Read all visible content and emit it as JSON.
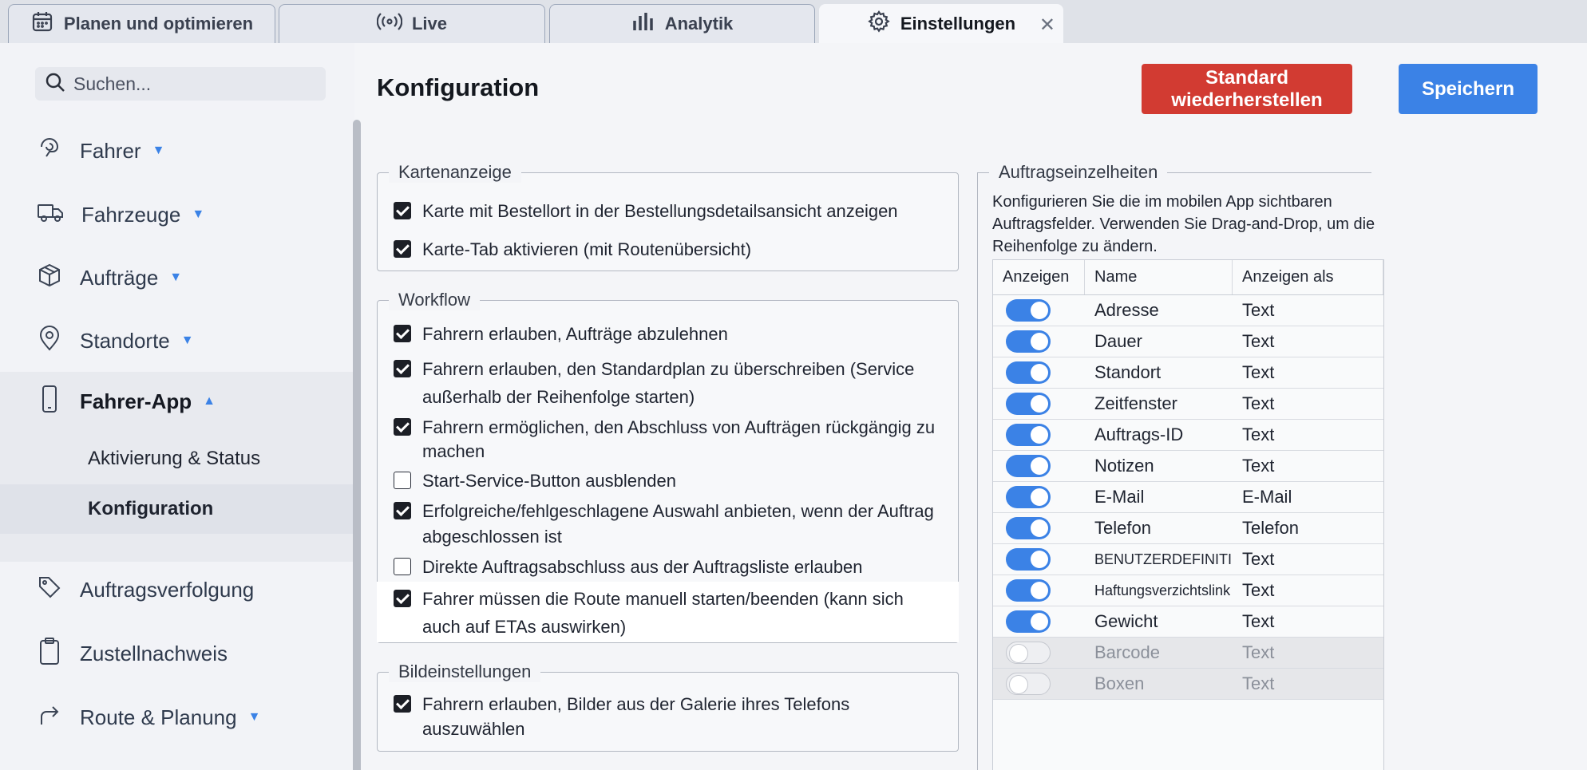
{
  "tabs": [
    {
      "label": "Planen und optimieren",
      "icon": "calendar-icon"
    },
    {
      "label": "Live",
      "icon": "broadcast-icon"
    },
    {
      "label": "Analytik",
      "icon": "bar-chart-icon"
    },
    {
      "label": "Einstellungen",
      "icon": "gear-icon",
      "active": true,
      "close": "✕"
    }
  ],
  "sidebar": {
    "search_placeholder": "Suchen...",
    "items": [
      {
        "label": "Fahrer",
        "icon": "driver-icon"
      },
      {
        "label": "Fahrzeuge",
        "icon": "truck-icon"
      },
      {
        "label": "Aufträge",
        "icon": "box-icon"
      },
      {
        "label": "Standorte",
        "icon": "location-pin-icon"
      },
      {
        "label": "Fahrer-App",
        "icon": "phone-icon",
        "expanded": true
      },
      {
        "label": "Auftragsverfolgung",
        "icon": "tag-icon"
      },
      {
        "label": "Zustellnachweis",
        "icon": "clipboard-icon"
      },
      {
        "label": "Route & Planung",
        "icon": "route-arrow-icon"
      }
    ],
    "subitems": [
      {
        "label": "Aktivierung & Status"
      },
      {
        "label": "Konfiguration",
        "selected": true
      }
    ]
  },
  "main": {
    "title": "Konfiguration",
    "reset_label": "Standard wiederherstellen",
    "save_label": "Speichern",
    "colors": {
      "reset": "#d23b32",
      "save": "#3b82e6"
    }
  },
  "kartenanzeige": {
    "legend": "Kartenanzeige",
    "options": [
      {
        "label": "Karte mit Bestellort in der Bestellungsdetailsansicht anzeigen",
        "checked": true
      },
      {
        "label": "Karte-Tab aktivieren (mit Routenübersicht)",
        "checked": true
      }
    ]
  },
  "workflow": {
    "legend": "Workflow",
    "options": [
      {
        "label": "Fahrern erlauben, Aufträge abzulehnen",
        "checked": true
      },
      {
        "label": "Fahrern erlauben, den Standardplan zu überschreiben (Service außerhalb der Reihenfolge starten)",
        "checked": true
      },
      {
        "label": "Fahrern ermöglichen, den Abschluss von Aufträgen rückgängig zu machen",
        "checked": true
      },
      {
        "label": "Start-Service-Button ausblenden",
        "checked": false
      },
      {
        "label": "Erfolgreiche/fehlgeschlagene Auswahl anbieten, wenn der Auftrag abgeschlossen ist",
        "checked": true
      },
      {
        "label": "Direkte Auftragsabschluss aus der Auftragsliste erlauben",
        "checked": false
      },
      {
        "label": "Fahrer müssen die Route manuell starten/beenden (kann sich auch auf ETAs auswirken)",
        "checked": true
      }
    ]
  },
  "bild": {
    "legend": "Bildeinstellungen",
    "options": [
      {
        "label": "Fahrern erlauben, Bilder aus der Galerie ihres Telefons auszuwählen",
        "checked": true
      }
    ]
  },
  "details": {
    "legend": "Auftragseinzelheiten",
    "description": "Konfigurieren Sie die im mobilen App sichtbaren Auftragsfelder. Verwenden Sie Drag-and-Drop, um die Reihenfolge zu ändern.",
    "columns": [
      "Anzeigen",
      "Name",
      "Anzeigen als"
    ],
    "rows": [
      {
        "name": "Adresse",
        "as": "Text",
        "on": true
      },
      {
        "name": "Dauer",
        "as": "Text",
        "on": true
      },
      {
        "name": "Standort",
        "as": "Text",
        "on": true
      },
      {
        "name": "Zeitfenster",
        "as": "Text",
        "on": true
      },
      {
        "name": "Auftrags-ID",
        "as": "Text",
        "on": true
      },
      {
        "name": "Notizen",
        "as": "Text",
        "on": true
      },
      {
        "name": "E-Mail",
        "as": "E-Mail",
        "on": true
      },
      {
        "name": "Telefon",
        "as": "Telefon",
        "on": true
      },
      {
        "name": "BENUTZERDEFINITI...",
        "as": "Text",
        "on": true
      },
      {
        "name": "Haftungsverzichtslink",
        "as": "Text",
        "on": true
      },
      {
        "name": "Gewicht",
        "as": "Text",
        "on": true
      },
      {
        "name": "Barcode",
        "as": "Text",
        "on": false
      },
      {
        "name": "Boxen",
        "as": "Text",
        "on": false
      }
    ]
  }
}
